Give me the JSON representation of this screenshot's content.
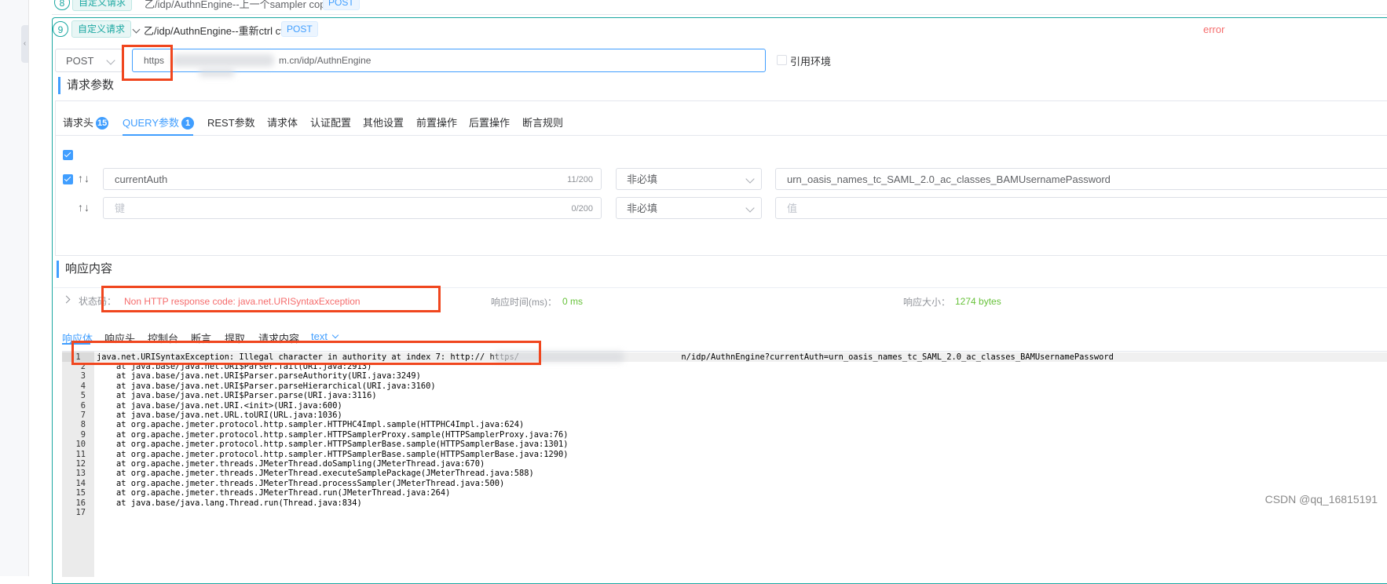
{
  "prev_row": {
    "index": "8",
    "tag": "自定义请求",
    "name": "乙/idp/AuthnEngine--上一个sampler copy",
    "method": "POST"
  },
  "step": {
    "index": "9",
    "tag": "自定义请求",
    "name": "乙/idp/AuthnEngine--重新ctrl cv",
    "method_tag": "POST",
    "status": "error"
  },
  "request": {
    "method": "POST",
    "url_prefix": "https",
    "url_suffix": "m.cn/idp/AuthnEngine",
    "use_env_label": "引用环境"
  },
  "params_section": {
    "title": "请求参数",
    "tabs": [
      {
        "label": "请求头",
        "badge": "15"
      },
      {
        "label": "QUERY参数",
        "badge": "1"
      },
      {
        "label": "REST参数"
      },
      {
        "label": "请求体"
      },
      {
        "label": "认证配置"
      },
      {
        "label": "其他设置"
      },
      {
        "label": "前置操作"
      },
      {
        "label": "后置操作"
      },
      {
        "label": "断言规则"
      }
    ],
    "rows": [
      {
        "key": "currentAuth",
        "key_counter": "11/200",
        "required": "非必填",
        "value": "urn_oasis_names_tc_SAML_2.0_ac_classes_BAMUsernamePassword"
      },
      {
        "key_placeholder": "键",
        "key_counter": "0/200",
        "required": "非必填",
        "value_placeholder": "值"
      }
    ],
    "sort_arrows": "↑↓"
  },
  "response_section": {
    "title": "响应内容",
    "status_label": "状态码：",
    "status_value": "Non HTTP response code: java.net.URISyntaxException",
    "time_label": "响应时间(ms)：",
    "time_value": "0 ms",
    "size_label": "响应大小：",
    "size_value": "1274 bytes",
    "tabs": [
      "响应体",
      "响应头",
      "控制台",
      "断言",
      "提取",
      "请求内容"
    ],
    "format": "text",
    "lines": [
      "java.net.URISyntaxException: Illegal character in authority at index 7: http:// https/                                 n/idp/AuthnEngine?currentAuth=urn_oasis_names_tc_SAML_2.0_ac_classes_BAMUsernamePassword",
      "    at java.base/java.net.URI$Parser.fail(URI.java:2913)",
      "    at java.base/java.net.URI$Parser.parseAuthority(URI.java:3249)",
      "    at java.base/java.net.URI$Parser.parseHierarchical(URI.java:3160)",
      "    at java.base/java.net.URI$Parser.parse(URI.java:3116)",
      "    at java.base/java.net.URI.<init>(URI.java:600)",
      "    at java.base/java.net.URL.toURI(URL.java:1036)",
      "    at org.apache.jmeter.protocol.http.sampler.HTTPHC4Impl.sample(HTTPHC4Impl.java:624)",
      "    at org.apache.jmeter.protocol.http.sampler.HTTPSamplerProxy.sample(HTTPSamplerProxy.java:76)",
      "    at org.apache.jmeter.protocol.http.sampler.HTTPSamplerBase.sample(HTTPSamplerBase.java:1301)",
      "    at org.apache.jmeter.protocol.http.sampler.HTTPSamplerBase.sample(HTTPSamplerBase.java:1290)",
      "    at org.apache.jmeter.threads.JMeterThread.doSampling(JMeterThread.java:670)",
      "    at org.apache.jmeter.threads.JMeterThread.executeSamplePackage(JMeterThread.java:588)",
      "    at org.apache.jmeter.threads.JMeterThread.processSampler(JMeterThread.java:500)",
      "    at org.apache.jmeter.threads.JMeterThread.run(JMeterThread.java:264)",
      "    at java.base/java.lang.Thread.run(Thread.java:834)",
      ""
    ]
  },
  "watermark": "CSDN @qq_16815191",
  "colors": {
    "primary": "#409eff",
    "teal": "#1aa7a1",
    "error": "#f56c6c",
    "success": "#67c23a",
    "highlight_box": "#f0461e"
  }
}
